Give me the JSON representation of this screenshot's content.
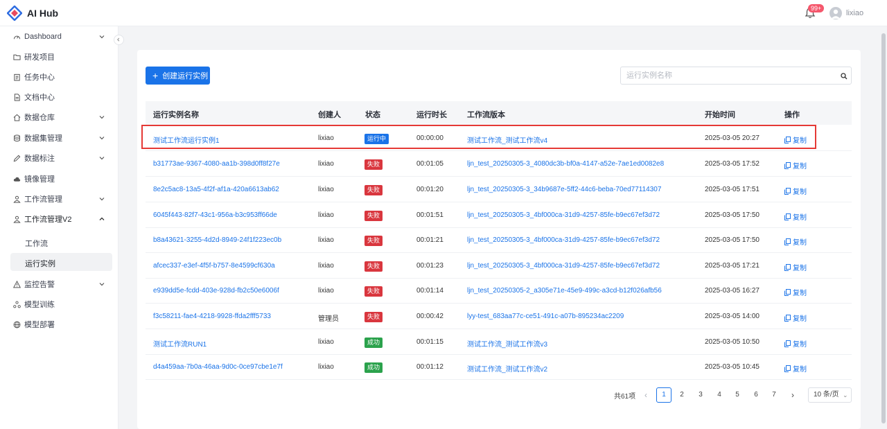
{
  "app": {
    "title": "AI Hub",
    "notification_count": "99+",
    "username": "lixiao"
  },
  "colors": {
    "primary": "#1a73e8",
    "running": "#1a73e8",
    "failed": "#d9363e",
    "success": "#2ba24c",
    "highlight": "#e53935"
  },
  "sidebar": {
    "items": [
      {
        "label": "Dashboard",
        "icon": "gauge-icon",
        "expandable": true
      },
      {
        "label": "研发项目",
        "icon": "folder-icon",
        "expandable": false
      },
      {
        "label": "任务中心",
        "icon": "clipboard-icon",
        "expandable": false
      },
      {
        "label": "文档中心",
        "icon": "document-icon",
        "expandable": false
      },
      {
        "label": "数据仓库",
        "icon": "home-icon",
        "expandable": true
      },
      {
        "label": "数据集管理",
        "icon": "database-icon",
        "expandable": true
      },
      {
        "label": "数据标注",
        "icon": "pencil-icon",
        "expandable": true
      },
      {
        "label": "镜像管理",
        "icon": "cloud-icon",
        "expandable": false
      },
      {
        "label": "工作流管理",
        "icon": "user-flow-icon",
        "expandable": true
      },
      {
        "label": "工作流管理V2",
        "icon": "user-flow-icon",
        "expandable": true,
        "expanded": true
      },
      {
        "label": "监控告警",
        "icon": "warning-icon",
        "expandable": true
      },
      {
        "label": "模型训练",
        "icon": "cluster-icon",
        "expandable": false
      },
      {
        "label": "模型部署",
        "icon": "globe-icon",
        "expandable": false
      }
    ],
    "subitems": [
      {
        "label": "工作流"
      },
      {
        "label": "运行实例",
        "active": true
      }
    ]
  },
  "toolbar": {
    "create_label": "创建运行实例",
    "search_placeholder": "运行实例名称"
  },
  "table": {
    "columns": [
      "运行实例名称",
      "创建人",
      "状态",
      "运行时长",
      "工作流版本",
      "开始时间",
      "操作"
    ],
    "rows": [
      {
        "name": "测试工作流运行实例1",
        "creator": "lixiao",
        "status": "运行中",
        "status_type": "running",
        "duration": "00:00:00",
        "version": "测试工作流_测试工作流v4",
        "start": "2025-03-05 20:27",
        "action": "复制"
      },
      {
        "name": "b31773ae-9367-4080-aa1b-398d0ff8f27e",
        "creator": "lixiao",
        "status": "失败",
        "status_type": "failed",
        "duration": "00:01:05",
        "version": "ljn_test_20250305-3_4080dc3b-bf0a-4147-a52e-7ae1ed0082e8",
        "start": "2025-03-05 17:52",
        "action": "复制"
      },
      {
        "name": "8e2c5ac8-13a5-4f2f-af1a-420a6613ab62",
        "creator": "lixiao",
        "status": "失败",
        "status_type": "failed",
        "duration": "00:01:20",
        "version": "ljn_test_20250305-3_34b9687e-5ff2-44c6-beba-70ed77114307",
        "start": "2025-03-05 17:51",
        "action": "复制"
      },
      {
        "name": "6045f443-82f7-43c1-956a-b3c953ff66de",
        "creator": "lixiao",
        "status": "失败",
        "status_type": "failed",
        "duration": "00:01:51",
        "version": "ljn_test_20250305-3_4bf000ca-31d9-4257-85fe-b9ec67ef3d72",
        "start": "2025-03-05 17:50",
        "action": "复制"
      },
      {
        "name": "b8a43621-3255-4d2d-8949-24f1f223ec0b",
        "creator": "lixiao",
        "status": "失败",
        "status_type": "failed",
        "duration": "00:01:21",
        "version": "ljn_test_20250305-3_4bf000ca-31d9-4257-85fe-b9ec67ef3d72",
        "start": "2025-03-05 17:50",
        "action": "复制"
      },
      {
        "name": "afcec337-e3ef-4f5f-b757-8e4599cf630a",
        "creator": "lixiao",
        "status": "失败",
        "status_type": "failed",
        "duration": "00:01:23",
        "version": "ljn_test_20250305-3_4bf000ca-31d9-4257-85fe-b9ec67ef3d72",
        "start": "2025-03-05 17:21",
        "action": "复制"
      },
      {
        "name": "e939dd5e-fcdd-403e-928d-fb2c50e6006f",
        "creator": "lixiao",
        "status": "失败",
        "status_type": "failed",
        "duration": "00:01:14",
        "version": "ljn_test_20250305-2_a305e71e-45e9-499c-a3cd-b12f026afb56",
        "start": "2025-03-05 16:27",
        "action": "复制"
      },
      {
        "name": "f3c58211-fae4-4218-9928-ffda2fff5733",
        "creator": "管理员",
        "status": "失败",
        "status_type": "failed",
        "duration": "00:00:42",
        "version": "lyy-test_683aa77c-ce51-491c-a07b-895234ac2209",
        "start": "2025-03-05 14:00",
        "action": "复制"
      },
      {
        "name": "测试工作流RUN1",
        "creator": "lixiao",
        "status": "成功",
        "status_type": "success",
        "duration": "00:01:15",
        "version": "测试工作流_测试工作流v3",
        "start": "2025-03-05 10:50",
        "action": "复制"
      },
      {
        "name": "d4a459aa-7b0a-46aa-9d0c-0ce97cbe1e7f",
        "creator": "lixiao",
        "status": "成功",
        "status_type": "success",
        "duration": "00:01:12",
        "version": "测试工作流_测试工作流v2",
        "start": "2025-03-05 10:45",
        "action": "复制"
      }
    ]
  },
  "pagination": {
    "total_label": "共61项",
    "pages": [
      "1",
      "2",
      "3",
      "4",
      "5",
      "6",
      "7"
    ],
    "current": "1",
    "page_size": "10 条/页"
  }
}
